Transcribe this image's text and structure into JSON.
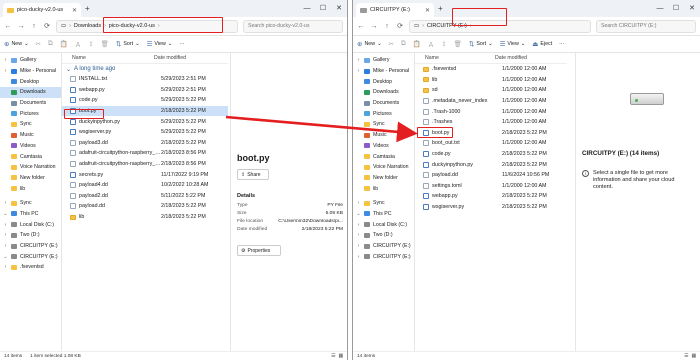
{
  "colors": {
    "accent": "#0067c0",
    "annotation": "#e41f1f",
    "selection": "#cce1f7",
    "folder": "#f5c242"
  },
  "left": {
    "tab_title": "pico-ducky-v2.0-us",
    "breadcrumb": [
      "Downloads",
      "pico-ducky-v2.0-us"
    ],
    "search_placeholder": "Search pico-ducky-v2.0-us",
    "toolbar": {
      "new": "New",
      "sort": "Sort",
      "view": "View"
    },
    "nav": [
      {
        "label": "Gallery",
        "icon": "gallery-icon",
        "color": "#6aa6e8",
        "chev": "›"
      },
      {
        "label": "Mike - Personal",
        "icon": "cloud-icon",
        "color": "#2b7de0",
        "chev": "›"
      },
      {
        "label": "Desktop",
        "icon": "desktop-icon",
        "color": "#3c8be0",
        "chev": ""
      },
      {
        "label": "Downloads",
        "icon": "download-icon",
        "color": "#2e9b5b",
        "chev": "",
        "active": true
      },
      {
        "label": "Documents",
        "icon": "document-icon",
        "color": "#7a8ea6",
        "chev": ""
      },
      {
        "label": "Pictures",
        "icon": "picture-icon",
        "color": "#4aa3df",
        "chev": ""
      },
      {
        "label": "Sync",
        "icon": "sync-folder-icon",
        "color": "#f5c242",
        "chev": ""
      },
      {
        "label": "Music",
        "icon": "music-icon",
        "color": "#e0602e",
        "chev": ""
      },
      {
        "label": "Videos",
        "icon": "video-icon",
        "color": "#8e59c9",
        "chev": ""
      },
      {
        "label": "Camtasia",
        "icon": "folder-icon",
        "color": "#f5c242",
        "chev": ""
      },
      {
        "label": "Voice Narration",
        "icon": "folder-icon",
        "color": "#f5c242",
        "chev": ""
      },
      {
        "label": "New folder",
        "icon": "folder-icon",
        "color": "#f5c242",
        "chev": ""
      },
      {
        "label": "lib",
        "icon": "folder-icon",
        "color": "#f5c242",
        "chev": ""
      },
      {
        "gap": true
      },
      {
        "label": "Sync",
        "icon": "sync-folder-icon",
        "color": "#f5c242",
        "chev": "›"
      },
      {
        "label": "This PC",
        "icon": "pc-icon",
        "color": "#3c8be0",
        "chev": "⌄"
      },
      {
        "label": "Local Disk (C:)",
        "icon": "disk-icon",
        "color": "#8a8a8a",
        "chev": "›"
      },
      {
        "label": "Two (D:)",
        "icon": "disk-icon",
        "color": "#8a8a8a",
        "chev": "›"
      },
      {
        "label": "CIRCUITPY (E:)",
        "icon": "usb-drive-icon",
        "color": "#8a8a8a",
        "chev": "›"
      },
      {
        "label": "CIRCUITPY (E:)",
        "icon": "usb-drive-icon",
        "color": "#8a8a8a",
        "chev": "⌄"
      },
      {
        "label": ".fseventsd",
        "icon": "folder-icon",
        "color": "#f5c242",
        "chev": "›"
      }
    ],
    "columns": {
      "name": "Name",
      "date": "Date modified"
    },
    "group": "A long time ago",
    "files": [
      {
        "name": "INSTALL.txt",
        "date": "5/29/2023 2:51 PM",
        "kind": "txt"
      },
      {
        "name": "webapp.py",
        "date": "5/29/2023 2:51 PM",
        "kind": "py"
      },
      {
        "name": "code.py",
        "date": "5/29/2023 5:22 PM",
        "kind": "py"
      },
      {
        "name": "boot.py",
        "date": "2/18/2023 5:22 PM",
        "kind": "py",
        "selected": true
      },
      {
        "name": "duckyinpython.py",
        "date": "5/29/2023 5:22 PM",
        "kind": "py"
      },
      {
        "name": "wsgiserver.py",
        "date": "5/29/2023 5:22 PM",
        "kind": "py"
      },
      {
        "name": "payload3.dd",
        "date": "2/18/2023 5:22 PM",
        "kind": "dd"
      },
      {
        "name": "adafruit-circuitpython-raspberry_pi_pico...",
        "date": "2/18/2023 8:56 PM",
        "kind": "uf2"
      },
      {
        "name": "adafruit-circuitpython-raspberry_pi_pico...",
        "date": "2/18/2023 8:56 PM",
        "kind": "uf2"
      },
      {
        "name": "secrets.py",
        "date": "11/17/2022 9:19 PM",
        "kind": "py"
      },
      {
        "name": "payload4.dd",
        "date": "10/2/2022 10:28 AM",
        "kind": "dd"
      },
      {
        "name": "payload2.dd",
        "date": "5/11/2022 5:22 PM",
        "kind": "dd"
      },
      {
        "name": "payload.dd",
        "date": "2/18/2023 5:22 PM",
        "kind": "dd"
      },
      {
        "name": "lib",
        "date": "2/18/2023 5:22 PM",
        "kind": "folder"
      }
    ],
    "details": {
      "filename": "boot.py",
      "share": "Share",
      "section": "Details",
      "rows": [
        {
          "k": "Type",
          "v": "PY File"
        },
        {
          "k": "Size",
          "v": "5.09 KB"
        },
        {
          "k": "File location",
          "v": "C:\\Users\\m32\\Downloads\\pi..."
        },
        {
          "k": "Date modified",
          "v": "2/18/2023 5:22 PM"
        }
      ],
      "properties": "Properties"
    },
    "status": {
      "count": "14 items",
      "selection": "1 item selected  1.08 KB"
    }
  },
  "right": {
    "tab_title": "CIRCUITPY (E:)",
    "breadcrumb": [
      "CIRCUITPY (E:)"
    ],
    "search_placeholder": "Search CIRCUITPY (E:)",
    "toolbar": {
      "new": "New",
      "sort": "Sort",
      "view": "View",
      "eject": "Eject"
    },
    "nav": [
      {
        "label": "Gallery",
        "icon": "gallery-icon",
        "color": "#6aa6e8",
        "chev": "›"
      },
      {
        "label": "Mike - Personal",
        "icon": "cloud-icon",
        "color": "#2b7de0",
        "chev": "›"
      },
      {
        "label": "Desktop",
        "icon": "desktop-icon",
        "color": "#3c8be0",
        "chev": ""
      },
      {
        "label": "Downloads",
        "icon": "download-icon",
        "color": "#2e9b5b",
        "chev": ""
      },
      {
        "label": "Documents",
        "icon": "document-icon",
        "color": "#7a8ea6",
        "chev": ""
      },
      {
        "label": "Pictures",
        "icon": "picture-icon",
        "color": "#4aa3df",
        "chev": ""
      },
      {
        "label": "Sync",
        "icon": "sync-folder-icon",
        "color": "#f5c242",
        "chev": ""
      },
      {
        "label": "Music",
        "icon": "music-icon",
        "color": "#e0602e",
        "chev": ""
      },
      {
        "label": "Videos",
        "icon": "video-icon",
        "color": "#8e59c9",
        "chev": ""
      },
      {
        "label": "Camtasia",
        "icon": "folder-icon",
        "color": "#f5c242",
        "chev": ""
      },
      {
        "label": "Voice Narration",
        "icon": "folder-icon",
        "color": "#f5c242",
        "chev": ""
      },
      {
        "label": "New folder",
        "icon": "folder-icon",
        "color": "#f5c242",
        "chev": ""
      },
      {
        "label": "lib",
        "icon": "folder-icon",
        "color": "#f5c242",
        "chev": ""
      },
      {
        "gap": true
      },
      {
        "label": "Sync",
        "icon": "sync-folder-icon",
        "color": "#f5c242",
        "chev": "›"
      },
      {
        "label": "This PC",
        "icon": "pc-icon",
        "color": "#3c8be0",
        "chev": "⌄"
      },
      {
        "label": "Local Disk (C:)",
        "icon": "disk-icon",
        "color": "#8a8a8a",
        "chev": "›"
      },
      {
        "label": "Two (D:)",
        "icon": "disk-icon",
        "color": "#8a8a8a",
        "chev": "›"
      },
      {
        "label": "CIRCUITPY (E:)",
        "icon": "usb-drive-icon",
        "color": "#8a8a8a",
        "chev": "›"
      },
      {
        "label": "CIRCUITPY (E:)",
        "icon": "usb-drive-icon",
        "color": "#8a8a8a",
        "chev": "›"
      }
    ],
    "columns": {
      "name": "Name",
      "date": "Date modified"
    },
    "files": [
      {
        "name": ".fseventsd",
        "date": "1/1/2000 12:00 AM",
        "kind": "folder"
      },
      {
        "name": "lib",
        "date": "1/1/2000 12:00 AM",
        "kind": "folder"
      },
      {
        "name": "sd",
        "date": "1/1/2000 12:00 AM",
        "kind": "folder"
      },
      {
        "name": ".metadata_never_index",
        "date": "1/1/2000 12:00 AM",
        "kind": "txt"
      },
      {
        "name": ".Trash-1000",
        "date": "1/1/2000 12:00 AM",
        "kind": "txt"
      },
      {
        "name": ".Trashes",
        "date": "1/1/2000 12:00 AM",
        "kind": "txt"
      },
      {
        "name": "boot.py",
        "date": "2/18/2023 5:22 PM",
        "kind": "py"
      },
      {
        "name": "boot_out.txt",
        "date": "1/1/2000 12:00 AM",
        "kind": "txt"
      },
      {
        "name": "code.py",
        "date": "2/18/2023 5:22 PM",
        "kind": "py"
      },
      {
        "name": "duckyinpython.py",
        "date": "2/18/2023 5:22 PM",
        "kind": "py"
      },
      {
        "name": "payload.dd",
        "date": "11/6/2024 10:56 PM",
        "kind": "dd"
      },
      {
        "name": "settings.toml",
        "date": "1/1/2000 12:00 AM",
        "kind": "txt"
      },
      {
        "name": "webapp.py",
        "date": "2/18/2023 5:22 PM",
        "kind": "py"
      },
      {
        "name": "wsgiserver.py",
        "date": "2/18/2023 5:22 PM",
        "kind": "py"
      }
    ],
    "details": {
      "heading": "CIRCUITPY (E:) (14 items)",
      "hint": "Select a single file to get more information and share your cloud content."
    },
    "status": {
      "count": "14 items"
    }
  }
}
